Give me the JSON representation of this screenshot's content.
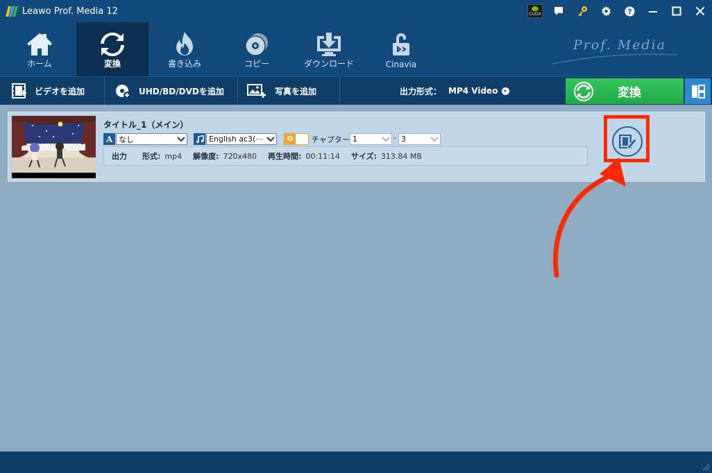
{
  "app": {
    "title": "Leawo Prof. Media 12",
    "logo_colors": [
      "#f0c419",
      "#3ca1e8",
      "#3bb24a"
    ]
  },
  "titlebar": {
    "buttons": [
      {
        "name": "cuda-icon",
        "label": "CUDA"
      },
      {
        "name": "chat-icon"
      },
      {
        "name": "key-icon"
      },
      {
        "name": "settings-icon"
      },
      {
        "name": "help-icon"
      },
      {
        "name": "minimize-icon"
      },
      {
        "name": "maximize-icon"
      },
      {
        "name": "close-icon"
      }
    ]
  },
  "nav": {
    "tabs": [
      {
        "label": "ホーム",
        "icon": "home-icon",
        "active": false
      },
      {
        "label": "変換",
        "icon": "refresh-icon",
        "active": true
      },
      {
        "label": "書き込み",
        "icon": "flame-icon",
        "active": false
      },
      {
        "label": "コピー",
        "icon": "disc-icon",
        "active": false
      },
      {
        "label": "ダウンロード",
        "icon": "download-icon",
        "active": false
      },
      {
        "label": "Cinavia",
        "icon": "unlock-icon",
        "active": false
      }
    ],
    "brand": "Prof. Media"
  },
  "toolbar": {
    "add_video": "ビデオを追加",
    "add_disc": "UHD/BD/DVDを追加",
    "add_photo": "写真を追加",
    "output_label": "出力形式：",
    "output_value": "MP4 Video",
    "convert": "変換"
  },
  "item": {
    "title": "タイトル_1（メイン）",
    "subtitle_badge": "A",
    "subtitle_value": "なし",
    "audio_value": "English ac3(⋯",
    "toggle_label": "O",
    "chapter_label": "チャプター",
    "chapter_from": "1",
    "chapter_to": "3",
    "chapter_sep": "-",
    "info": {
      "output_label": "出力",
      "format_label": "形式:",
      "format_value": "mp4",
      "resolution_label": "解像度:",
      "resolution_value": "720x480",
      "duration_label": "再生時間:",
      "duration_value": "00:11:14",
      "size_label": "サイズ:",
      "size_value": "313.84 MB"
    }
  },
  "annotation": {
    "color": "#ff2a00"
  },
  "colors": {
    "accent_green": "#28b44d",
    "header": "#124a7d",
    "main_bg": "#8fabc2"
  }
}
